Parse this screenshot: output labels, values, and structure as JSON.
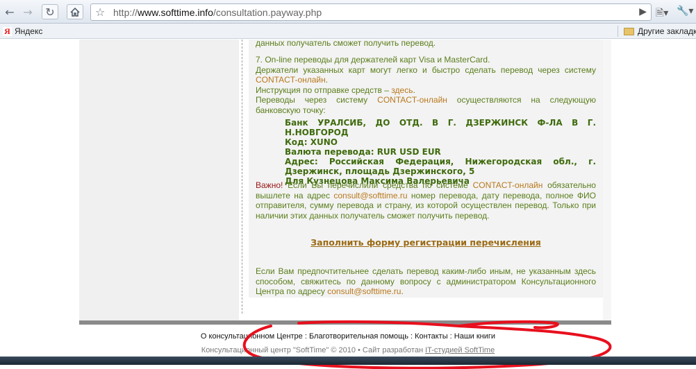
{
  "browser": {
    "url_host": "www.softtime.info",
    "url_path": "/consultation.payway.php",
    "url_scheme": "http://",
    "bookmarks": {
      "yandex": "Яндекс",
      "other": "Другие закладк"
    }
  },
  "content": {
    "p0": "данных получатель сможет получить перевод.",
    "p1_line1": "7. On-line переводы для держателей карт Visa и MasterCard.",
    "p1_line2": "Держатели указанных карт могут легко и быстро сделать перевод через систему",
    "p1_contact": "CONTACT-онлайн",
    "p1_instr_text": "Инструкция по отправке средств –",
    "p1_instr_link": "здесь",
    "p1_transfer_a": "Переводы через систему",
    "p1_transfer_contact": "CONTACT-онлайн",
    "p1_transfer_b": "осуществляются на следующую банковскую точку:",
    "bank_line1": "Банк УРАЛСИБ, ДО ОТД. В Г. ДЗЕРЖИНСК Ф-ЛА В Г. Н.НОВГОРОД",
    "bank_line2": "Код: XUNO",
    "bank_line3": "Валюта перевода: RUR USD EUR",
    "bank_line4": "Адрес: Российская Федерация, Нижегородская обл., г. Дзержинск, площадь Дзержинского, 5",
    "bank_line5": "Для Кузнецова Максима Валерьевича",
    "p2_important": "Важно!",
    "p2_a": "Если Вы перечислили средства по системе",
    "p2_contact": "CONTACT-онлайн",
    "p2_b": "обязательно вышлете на адрес",
    "p2_email": "consult@softtime.ru",
    "p2_c": "номер перевода, дату перевода, полное ФИО отправителя, сумму перевода и страну, из которой осуществлен перевод. Только при наличии этих данных получатель сможет получить перевод.",
    "form_link": "Заполнить форму регистрации перечисления",
    "p3_a": "Если Вам предпочтительнее сделать перевод каким-либо иным, не указанным здесь способом, свяжитесь по данному вопросу с администратором Консультационного Центра по адресу",
    "p3_email": "consult@softtime.ru"
  },
  "footer": {
    "links": "О консультационном Центре : Благотворительная помощь : Контакты : Наши книги",
    "copyright": "Консультационный центр \"SoftTime\" © 2010 • Сайт разработан",
    "studio": "IT-студией SoftTime"
  },
  "colors": {
    "text_green": "#5a7d1a",
    "accent_orange": "#b8781c",
    "important_red": "#9a1616",
    "annotation_red": "#e8101e"
  }
}
